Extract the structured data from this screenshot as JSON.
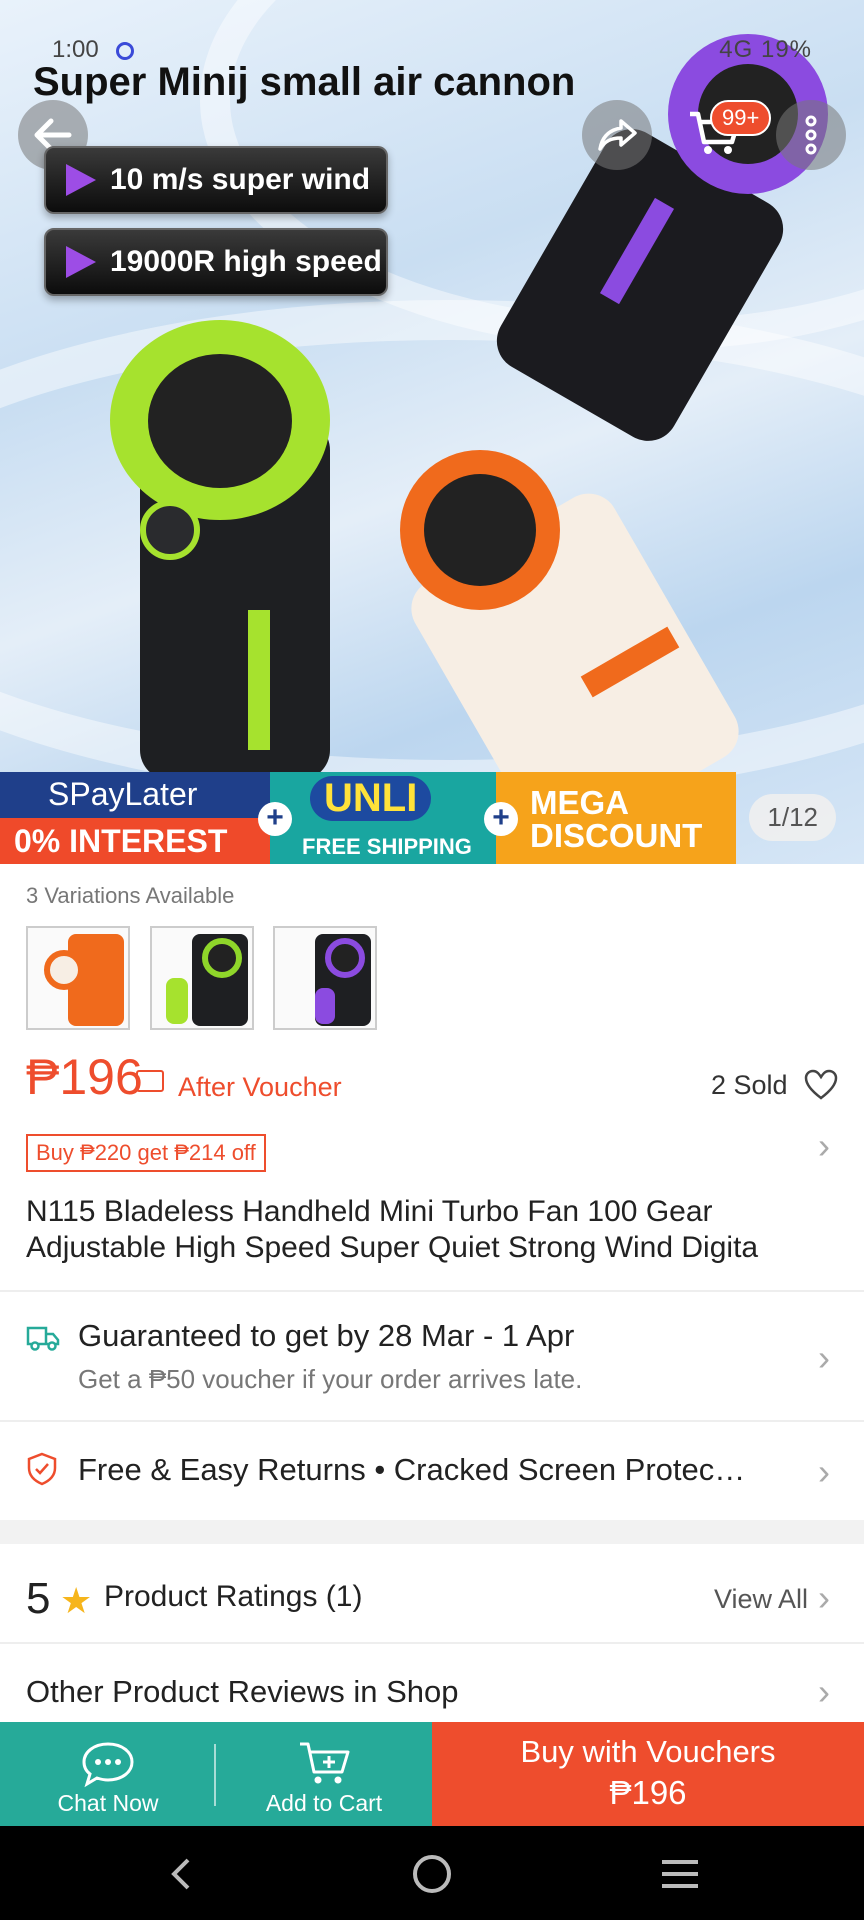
{
  "status_bar": {
    "time": "1:00",
    "right_text": "4G 19%"
  },
  "hero": {
    "overlay_title": "Super Minij small air cannon",
    "features": [
      "10 m/s super wind",
      "19000R high speed"
    ],
    "cart_badge": "99+",
    "image_counter": "1/12"
  },
  "promo_banner": {
    "spaylater": "SPayLater",
    "interest": "0% INTEREST",
    "unli": "UNLI",
    "free_shipping": "FREE SHIPPING",
    "mega": "MEGA",
    "discount": "DISCOUNT"
  },
  "variations": {
    "label": "3 Variations Available",
    "colors": [
      "#f06a1c",
      "#8fd62a",
      "#8b4be0"
    ]
  },
  "price": {
    "amount": "₱196",
    "after_voucher": "After Voucher",
    "sold": "2 Sold"
  },
  "promo_tag": "Buy ₱220 get ₱214 off",
  "product_title": {
    "line1": "N115 Bladeless Handheld Mini Turbo Fan 100 Gear",
    "line2": "Adjustable High Speed Super Quiet Strong Wind Digita"
  },
  "shipping": {
    "main": "Guaranteed to get by 28 Mar - 1 Apr",
    "sub": "Get a ₱50 voucher if your order arrives late."
  },
  "returns": "Free & Easy Returns  •  Cracked Screen Protec…",
  "ratings": {
    "score": "5",
    "label": "Product Ratings (1)",
    "view_all": "View All"
  },
  "other_reviews": "Other Product Reviews in Shop",
  "bottom_bar": {
    "chat": "Chat Now",
    "add_to_cart": "Add to Cart",
    "buy_line1": "Buy with Vouchers",
    "buy_line2": "₱196"
  },
  "colors": {
    "accent": "#ee4d2d",
    "teal": "#26aa99"
  }
}
